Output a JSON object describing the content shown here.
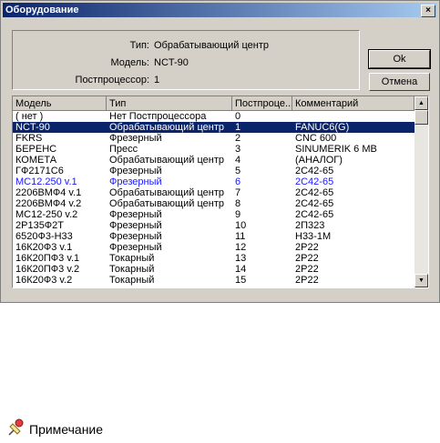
{
  "window": {
    "title": "Оборудование",
    "close_glyph": "×"
  },
  "info": {
    "type_label": "Тип:",
    "type_value": "Обрабатывающий центр",
    "model_label": "Модель:",
    "model_value": "NCT-90",
    "post_label": "Постпроцессор:",
    "post_value": "1"
  },
  "buttons": {
    "ok": "Ok",
    "cancel": "Отмена"
  },
  "columns": [
    "Модель",
    "Тип",
    "Постпроце...",
    "Комментарий"
  ],
  "rows": [
    {
      "model": "( нет )",
      "type": "Нет Постпроцессора",
      "post": "0",
      "comment": ""
    },
    {
      "model": "NCT-90",
      "type": "Обрабатывающий центр",
      "post": "1",
      "comment": "FANUC6(G)",
      "selected": true
    },
    {
      "model": "FKRS",
      "type": "Фрезерный",
      "post": "2",
      "comment": "CNC 600"
    },
    {
      "model": "БЕРЕНС",
      "type": "Пресс",
      "post": "3",
      "comment": "SINUMERIK 6 MB"
    },
    {
      "model": "КОМЕТА",
      "type": "Обрабатывающий центр",
      "post": "4",
      "comment": "(АНАЛОГ)"
    },
    {
      "model": "ГФ2171С6",
      "type": "Фрезерный",
      "post": "5",
      "comment": "2С42-65"
    },
    {
      "model": "МС12.250 v.1",
      "type": "Фрезерный",
      "post": "6",
      "comment": "2С42-65",
      "blue": true
    },
    {
      "model": "2206ВМФ4 v.1",
      "type": "Обрабатывающий центр",
      "post": "7",
      "comment": "2С42-65"
    },
    {
      "model": "2206ВМФ4 v.2",
      "type": "Обрабатывающий центр",
      "post": "8",
      "comment": "2С42-65"
    },
    {
      "model": "МС12-250 v.2",
      "type": "Фрезерный",
      "post": "9",
      "comment": "2С42-65"
    },
    {
      "model": "2Р135Ф2Т",
      "type": "Фрезерный",
      "post": "10",
      "comment": "2П323"
    },
    {
      "model": "6520Ф3-Н33",
      "type": "Фрезерный",
      "post": "11",
      "comment": "Н33-1М"
    },
    {
      "model": "16К20Ф3 v.1",
      "type": "Фрезерный",
      "post": "12",
      "comment": "2Р22"
    },
    {
      "model": "16К20ПФ3 v.1",
      "type": "Токарный",
      "post": "13",
      "comment": "2Р22"
    },
    {
      "model": "16К20ПФ3 v.2",
      "type": "Токарный",
      "post": "14",
      "comment": "2Р22"
    },
    {
      "model": "16К20Ф3 v.2",
      "type": "Токарный",
      "post": "15",
      "comment": "2Р22"
    }
  ],
  "scrollbar": {
    "up_glyph": "▲",
    "down_glyph": "▼"
  },
  "note": {
    "icon": "pushpin-note-icon",
    "text": "Примечание"
  },
  "colors": {
    "selection": "#0a246a",
    "title_start": "#0a246a",
    "title_end": "#a6caf0",
    "blue_row": "#1a1aff"
  }
}
